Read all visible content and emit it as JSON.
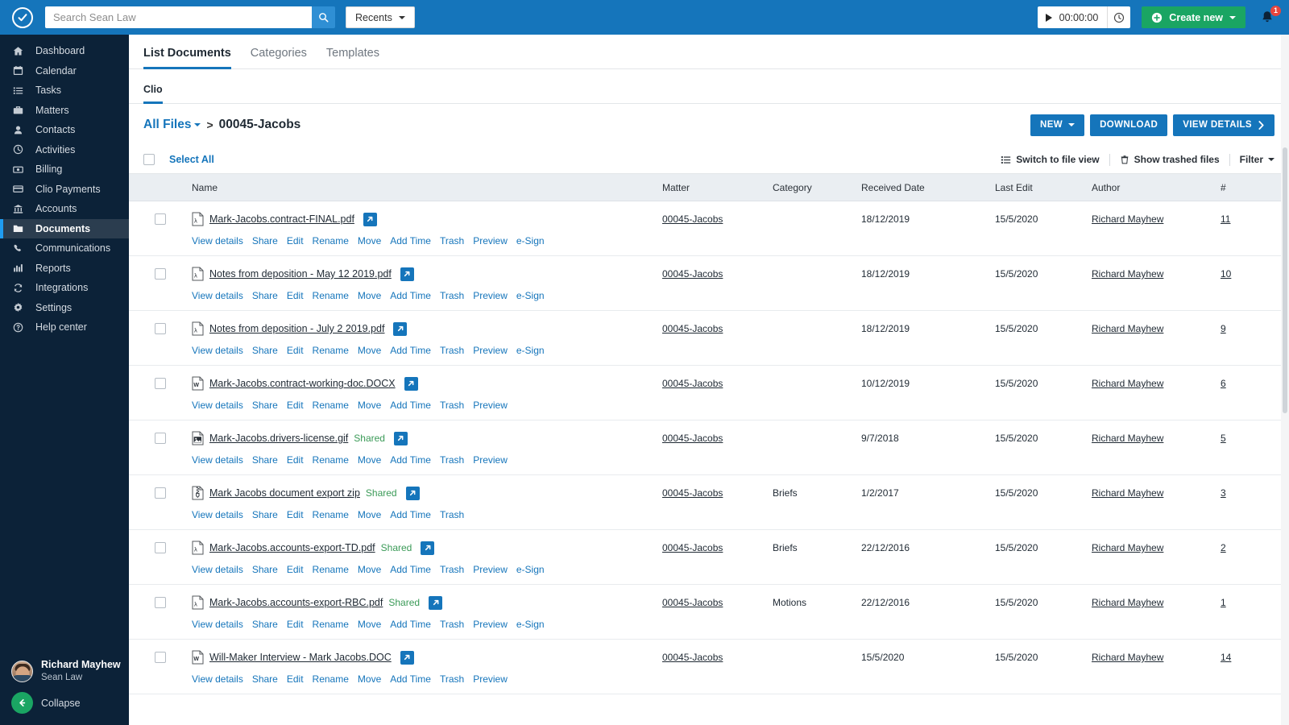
{
  "topbar": {
    "logo_icon": "check-circle-logo",
    "search": {
      "placeholder": "Search Sean Law",
      "value": "",
      "icon": "search-icon"
    },
    "recents_label": "Recents",
    "timer": {
      "value": "00:00:00",
      "play_icon": "play-icon",
      "clock_icon": "clock-icon"
    },
    "create_label": "Create new",
    "create_icon": "plus-circle-icon",
    "bell_icon": "bell-icon",
    "bell_count": "1",
    "accent_blue": "#1575bb",
    "accent_green": "#1aa563",
    "badge_red": "#e8453c"
  },
  "sidebar": {
    "items": [
      {
        "label": "Dashboard",
        "icon": "home-icon",
        "active": false
      },
      {
        "label": "Calendar",
        "icon": "calendar-icon",
        "active": false
      },
      {
        "label": "Tasks",
        "icon": "list-icon",
        "active": false
      },
      {
        "label": "Matters",
        "icon": "briefcase-icon",
        "active": false
      },
      {
        "label": "Contacts",
        "icon": "person-icon",
        "active": false
      },
      {
        "label": "Activities",
        "icon": "clock-icon",
        "active": false
      },
      {
        "label": "Billing",
        "icon": "money-icon",
        "active": false
      },
      {
        "label": "Clio Payments",
        "icon": "card-icon",
        "active": false
      },
      {
        "label": "Accounts",
        "icon": "bank-icon",
        "active": false
      },
      {
        "label": "Documents",
        "icon": "folder-icon",
        "active": true
      },
      {
        "label": "Communications",
        "icon": "phone-icon",
        "active": false
      },
      {
        "label": "Reports",
        "icon": "bar-chart-icon",
        "active": false
      },
      {
        "label": "Integrations",
        "icon": "refresh-icon",
        "active": false
      },
      {
        "label": "Settings",
        "icon": "gear-icon",
        "active": false
      },
      {
        "label": "Help center",
        "icon": "question-icon",
        "active": false
      }
    ],
    "user": {
      "name": "Richard Mayhew",
      "org": "Sean Law",
      "avatar_icon": "avatar"
    },
    "collapse_label": "Collapse",
    "collapse_icon": "arrow-left-icon",
    "bg": "#0c2238",
    "active_bg": "#2b3d4f",
    "active_accent": "#1f9cf0"
  },
  "tabs": [
    {
      "label": "List Documents",
      "active": true
    },
    {
      "label": "Categories",
      "active": false
    },
    {
      "label": "Templates",
      "active": false
    }
  ],
  "subtabs": [
    {
      "label": "Clio",
      "active": true
    }
  ],
  "breadcrumb": {
    "root_label": "All Files",
    "separator": ">",
    "current_label": "00045-Jacobs"
  },
  "page_actions": [
    {
      "label": "NEW",
      "caret": true
    },
    {
      "label": "DOWNLOAD",
      "caret": false
    },
    {
      "label": "VIEW DETAILS",
      "chevron": true
    }
  ],
  "toolbar": {
    "select_all_label": "Select All",
    "switch_view_label": "Switch to file view",
    "switch_view_icon": "list-view-icon",
    "trashed_label": "Show trashed files",
    "trashed_icon": "trash-icon",
    "filter_label": "Filter"
  },
  "table": {
    "columns": [
      "Name",
      "Matter",
      "Category",
      "Received Date",
      "Last Edit",
      "Author",
      "#"
    ],
    "rows": [
      {
        "name": "Mark-Jacobs.contract-FINAL.pdf",
        "file_icon": "pdf-icon",
        "shared": "",
        "matter": "00045-Jacobs",
        "category": "",
        "received": "18/12/2019",
        "last_edit": "15/5/2020",
        "author": "Richard Mayhew",
        "num": "11",
        "actions": [
          "View details",
          "Share",
          "Edit",
          "Rename",
          "Move",
          "Add Time",
          "Trash",
          "Preview",
          "e-Sign"
        ]
      },
      {
        "name": "Notes from deposition - May 12 2019.pdf",
        "file_icon": "pdf-icon",
        "shared": "",
        "matter": "00045-Jacobs",
        "category": "",
        "received": "18/12/2019",
        "last_edit": "15/5/2020",
        "author": "Richard Mayhew",
        "num": "10",
        "actions": [
          "View details",
          "Share",
          "Edit",
          "Rename",
          "Move",
          "Add Time",
          "Trash",
          "Preview",
          "e-Sign"
        ]
      },
      {
        "name": "Notes from deposition - July 2 2019.pdf",
        "file_icon": "pdf-icon",
        "shared": "",
        "matter": "00045-Jacobs",
        "category": "",
        "received": "18/12/2019",
        "last_edit": "15/5/2020",
        "author": "Richard Mayhew",
        "num": "9",
        "actions": [
          "View details",
          "Share",
          "Edit",
          "Rename",
          "Move",
          "Add Time",
          "Trash",
          "Preview",
          "e-Sign"
        ]
      },
      {
        "name": "Mark-Jacobs.contract-working-doc.DOCX",
        "file_icon": "word-icon",
        "shared": "",
        "matter": "00045-Jacobs",
        "category": "",
        "received": "10/12/2019",
        "last_edit": "15/5/2020",
        "author": "Richard Mayhew",
        "num": "6",
        "actions": [
          "View details",
          "Share",
          "Edit",
          "Rename",
          "Move",
          "Add Time",
          "Trash",
          "Preview"
        ]
      },
      {
        "name": "Mark-Jacobs.drivers-license.gif",
        "file_icon": "image-icon",
        "shared": "Shared",
        "matter": "00045-Jacobs",
        "category": "",
        "received": "9/7/2018",
        "last_edit": "15/5/2020",
        "author": "Richard Mayhew",
        "num": "5",
        "actions": [
          "View details",
          "Share",
          "Edit",
          "Rename",
          "Move",
          "Add Time",
          "Trash",
          "Preview"
        ]
      },
      {
        "name": "Mark Jacobs document export zip",
        "file_icon": "zip-icon",
        "shared": "Shared",
        "matter": "00045-Jacobs",
        "category": "Briefs",
        "received": "1/2/2017",
        "last_edit": "15/5/2020",
        "author": "Richard Mayhew",
        "num": "3",
        "actions": [
          "View details",
          "Share",
          "Edit",
          "Rename",
          "Move",
          "Add Time",
          "Trash"
        ]
      },
      {
        "name": "Mark-Jacobs.accounts-export-TD.pdf",
        "file_icon": "pdf-icon",
        "shared": "Shared",
        "matter": "00045-Jacobs",
        "category": "Briefs",
        "received": "22/12/2016",
        "last_edit": "15/5/2020",
        "author": "Richard Mayhew",
        "num": "2",
        "actions": [
          "View details",
          "Share",
          "Edit",
          "Rename",
          "Move",
          "Add Time",
          "Trash",
          "Preview",
          "e-Sign"
        ]
      },
      {
        "name": "Mark-Jacobs.accounts-export-RBC.pdf",
        "file_icon": "pdf-icon",
        "shared": "Shared",
        "matter": "00045-Jacobs",
        "category": "Motions",
        "received": "22/12/2016",
        "last_edit": "15/5/2020",
        "author": "Richard Mayhew",
        "num": "1",
        "actions": [
          "View details",
          "Share",
          "Edit",
          "Rename",
          "Move",
          "Add Time",
          "Trash",
          "Preview",
          "e-Sign"
        ]
      },
      {
        "name": "Will-Maker Interview - Mark Jacobs.DOC",
        "file_icon": "word-icon",
        "shared": "",
        "matter": "00045-Jacobs",
        "category": "",
        "received": "15/5/2020",
        "last_edit": "15/5/2020",
        "author": "Richard Mayhew",
        "num": "14",
        "actions": [
          "View details",
          "Share",
          "Edit",
          "Rename",
          "Move",
          "Add Time",
          "Trash",
          "Preview"
        ]
      }
    ]
  }
}
